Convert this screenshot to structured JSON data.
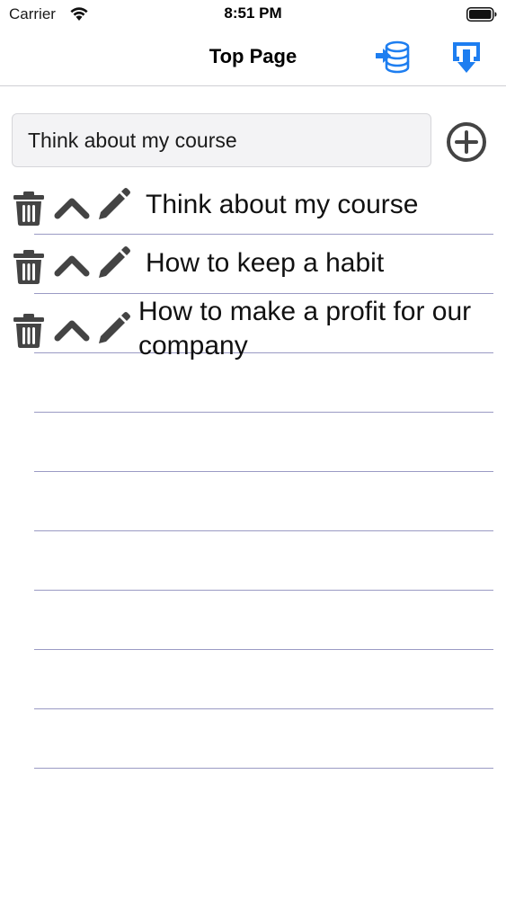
{
  "status_bar": {
    "carrier": "Carrier",
    "time": "8:51 PM"
  },
  "nav": {
    "title": "Top Page",
    "left_action_icon": "database-import-icon",
    "right_action_icon": "download-icon",
    "accent_color": "#1e7ef0"
  },
  "input": {
    "value": "Think about my course"
  },
  "items": [
    {
      "text": "Think about my course"
    },
    {
      "text": "How to keep a habit"
    },
    {
      "text": "How to make a profit for our company"
    }
  ],
  "colors": {
    "icon": "#444444",
    "rule": "#9a9ac4"
  }
}
